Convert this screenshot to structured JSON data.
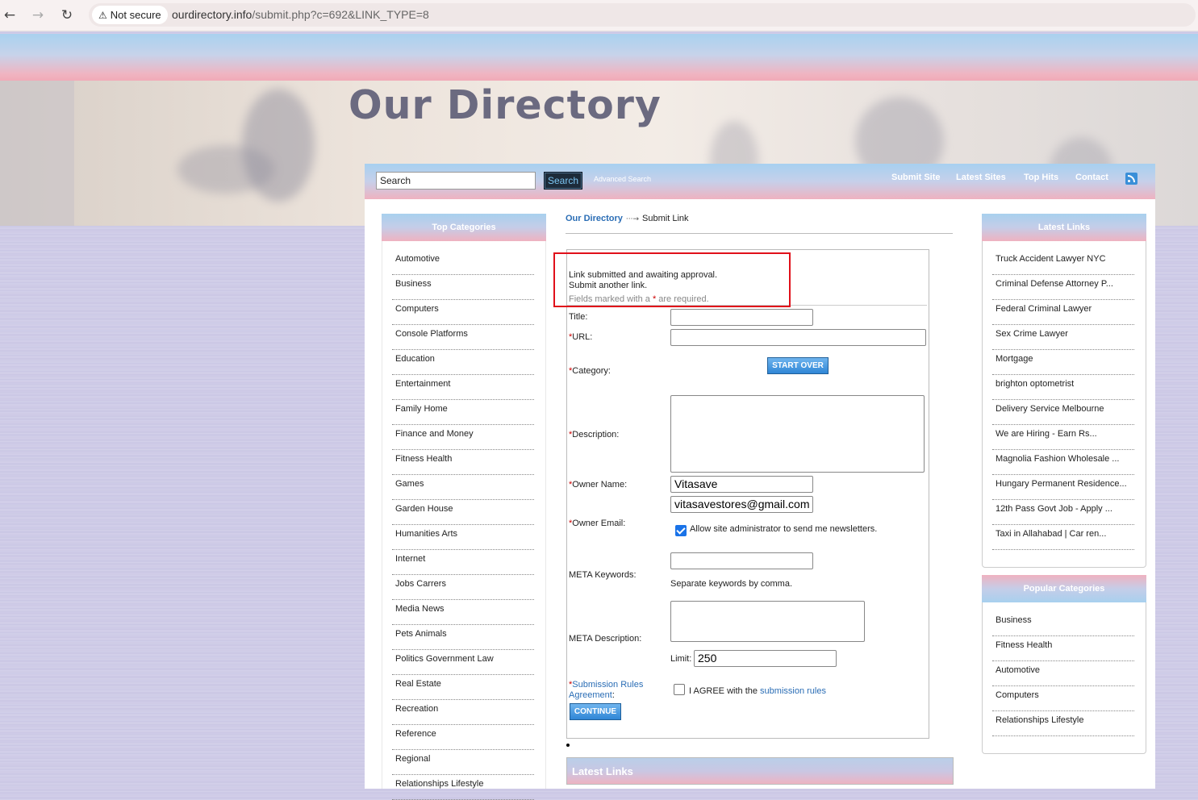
{
  "browser": {
    "security_label": "Not secure",
    "url_domain": "ourdirectory.info",
    "url_path": "/submit.php?c=692&LINK_TYPE=8"
  },
  "site": {
    "logo": "Our Directory"
  },
  "navbar": {
    "search_value": "Search",
    "search_button": "Search",
    "advanced_search": "Advanced Search",
    "links": [
      "Submit Site",
      "Latest Sites",
      "Top Hits",
      "Contact"
    ]
  },
  "top_categories": {
    "title": "Top Categories",
    "items": [
      "Automotive",
      "Business",
      "Computers",
      "Console Platforms",
      "Education",
      "Entertainment",
      "Family Home",
      "Finance and Money",
      "Fitness Health",
      "Games",
      "Garden House",
      "Humanities Arts",
      "Internet",
      "Jobs Carrers",
      "Media News",
      "Pets Animals",
      "Politics Government Law",
      "Real Estate",
      "Recreation",
      "Reference",
      "Regional",
      "Relationships Lifestyle"
    ]
  },
  "breadcrumb": {
    "home": "Our Directory",
    "current": "Submit Link"
  },
  "form": {
    "message_line1": "Link submitted and awaiting approval.",
    "message_line2": "Submit another link.",
    "required_note_prefix": "Fields marked with a",
    "required_note_suffix": "are required.",
    "asterisk": "*",
    "title_label": "Title:",
    "url_label": "URL:",
    "category_label": "Category:",
    "start_over": "START OVER",
    "description_label": "Description:",
    "owner_name_label": "Owner Name:",
    "owner_name_value": "Vitasave",
    "owner_email_label": "Owner Email:",
    "owner_email_value": "vitasavestores@gmail.com",
    "newsletter_label": "Allow site administrator to send me newsletters.",
    "newsletter_checked": true,
    "meta_keywords_label": "META Keywords:",
    "meta_keywords_hint": "Separate keywords by comma.",
    "meta_description_label": "META Description:",
    "limit_label": "Limit:",
    "limit_value": "250",
    "rules_label_line1": "Submission Rules",
    "rules_label_line2": "Agreement",
    "rules_colon": ":",
    "agree_prefix": "I AGREE with the",
    "agree_link": "submission rules",
    "agree_checked": false,
    "continue_button": "CONTINUE"
  },
  "latest_links_bottom": {
    "title": "Latest Links"
  },
  "latest_links": {
    "title": "Latest Links",
    "items": [
      "Truck Accident Lawyer NYC",
      "Criminal Defense Attorney P...",
      "Federal Criminal Lawyer",
      "Sex Crime Lawyer",
      "Mortgage",
      "brighton optometrist",
      "Delivery Service Melbourne",
      "We are Hiring - Earn Rs...",
      "Magnolia Fashion Wholesale ...",
      "Hungary Permanent Residence...",
      "12th Pass Govt Job - Apply ...",
      "Taxi in Allahabad | Car ren..."
    ]
  },
  "popular_categories": {
    "title": "Popular Categories",
    "items": [
      "Business",
      "Fitness Health",
      "Automotive",
      "Computers",
      "Relationships Lifestyle"
    ]
  },
  "colors": {
    "accent_blue": "#2a6db5",
    "required_red": "#cc0000",
    "annotation_red": "#e0101a"
  }
}
